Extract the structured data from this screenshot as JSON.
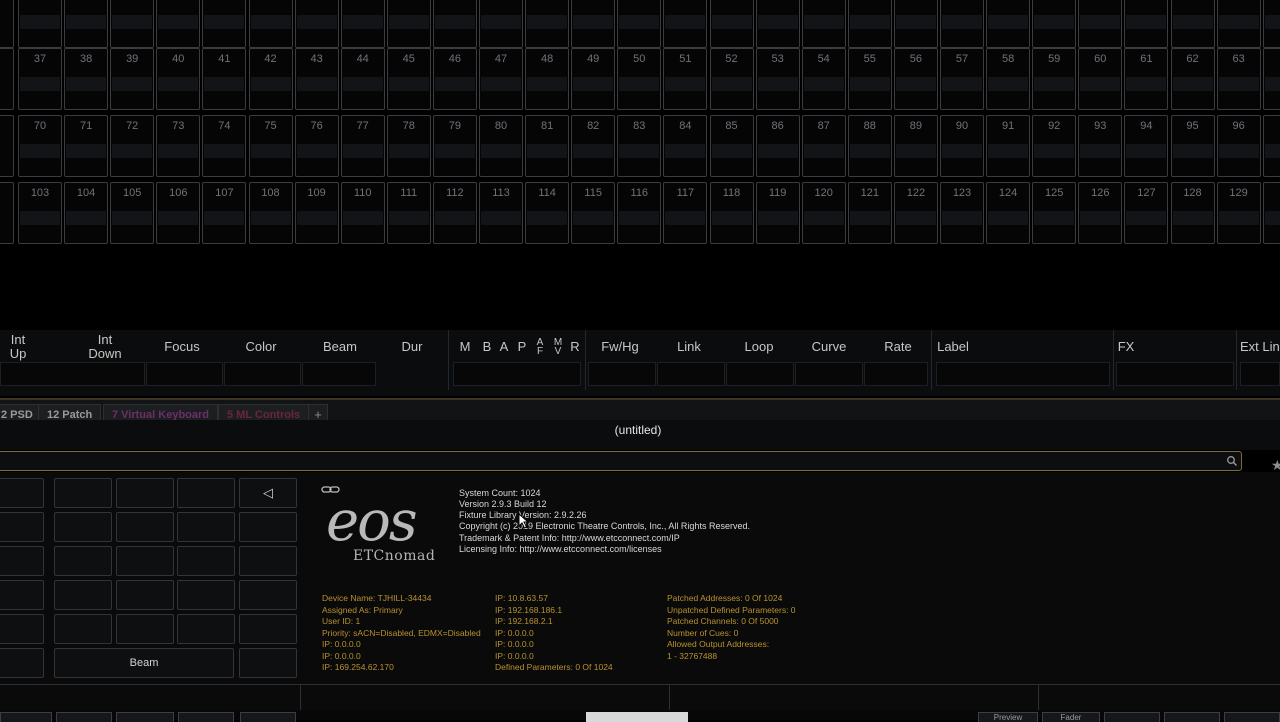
{
  "channels": {
    "rows": [
      [
        "",
        "",
        "",
        "",
        "",
        "",
        "",
        "",
        "",
        "",
        "",
        "",
        "",
        "",
        "",
        "",
        "",
        "",
        "",
        "",
        "",
        "",
        "",
        "",
        "",
        "",
        "",
        ""
      ],
      [
        "37",
        "38",
        "39",
        "40",
        "41",
        "42",
        "43",
        "44",
        "45",
        "46",
        "47",
        "48",
        "49",
        "50",
        "51",
        "52",
        "53",
        "54",
        "55",
        "56",
        "57",
        "58",
        "59",
        "60",
        "61",
        "62",
        "63",
        ""
      ],
      [
        "70",
        "71",
        "72",
        "73",
        "74",
        "75",
        "76",
        "77",
        "78",
        "79",
        "80",
        "81",
        "82",
        "83",
        "84",
        "85",
        "86",
        "87",
        "88",
        "89",
        "90",
        "91",
        "92",
        "93",
        "94",
        "95",
        "96",
        ""
      ],
      [
        "103",
        "104",
        "105",
        "106",
        "107",
        "108",
        "109",
        "110",
        "111",
        "112",
        "113",
        "114",
        "115",
        "116",
        "117",
        "118",
        "119",
        "120",
        "121",
        "122",
        "123",
        "124",
        "125",
        "126",
        "127",
        "128",
        "129",
        ""
      ]
    ],
    "row_tops": [
      -14,
      48,
      115,
      182
    ]
  },
  "attributes": {
    "int_up": "Int\nUp",
    "int_down": "Int\nDown",
    "focus": "Focus",
    "color": "Color",
    "beam": "Beam",
    "dur": "Dur",
    "m": "M",
    "b": "B",
    "a": "A",
    "p": "P",
    "af": "A\nF",
    "mv": "M\nV",
    "r": "R",
    "fw_hg": "Fw/Hg",
    "link": "Link",
    "loop": "Loop",
    "curve": "Curve",
    "rate": "Rate",
    "label": "Label",
    "fx": "FX",
    "ext_link": "Ext Lin"
  },
  "tabs": [
    {
      "label": "2 PSD",
      "style": "plain"
    },
    {
      "label": "12 Patch",
      "style": "plain"
    },
    {
      "label": "7 Virtual Keyboard",
      "style": "virt"
    },
    {
      "label": "5 ML Controls",
      "style": "ml"
    }
  ],
  "document_title": "(untitled)",
  "keypad": {
    "back_symbol": "◁",
    "beam_label": "Beam"
  },
  "about": {
    "logo_text": "eos",
    "logo_sub": "ETCnomad",
    "info": [
      "System Count: 1024",
      "Version 2.9.3 Build 12",
      "Fixture Library Version: 2.9.2.26",
      "Copyright (c) 2019 Electronic Theatre Controls, Inc., All Rights Reserved.",
      "Trademark & Patent Info: http://www.etcconnect.com/IP",
      "Licensing Info: http://www.etcconnect.com/licenses"
    ],
    "col1": [
      "Device Name: TJHILL-34434",
      "Assigned As: Primary",
      "User ID: 1",
      "Priority:  sACN=Disabled,  EDMX=Disabled",
      "IP: 0.0.0.0",
      "IP: 0.0.0.0",
      "IP: 169.254.62.170"
    ],
    "col2": [
      "IP: 10.8.63.57",
      "IP: 192.168.186.1",
      "IP: 192.168.2.1",
      "IP: 0.0.0.0",
      "IP: 0.0.0.0",
      "IP: 0.0.0.0",
      "Defined Parameters: 0 Of 1024"
    ],
    "col3": [
      "Patched Addresses: 0 Of 1024",
      "Unpatched Defined Parameters: 0",
      "Patched Channels: 0 Of 5000",
      "Number of Cues: 0",
      "Allowed Output Addresses:",
      "   1 - 32767488"
    ]
  },
  "bottom_buttons": {
    "preview": "Preview",
    "fader": "Fader"
  },
  "colors": {
    "accent_gold": "#b8922e",
    "cell_border": "#3a3c3f",
    "cmdline_border": "#7d6a3c"
  }
}
